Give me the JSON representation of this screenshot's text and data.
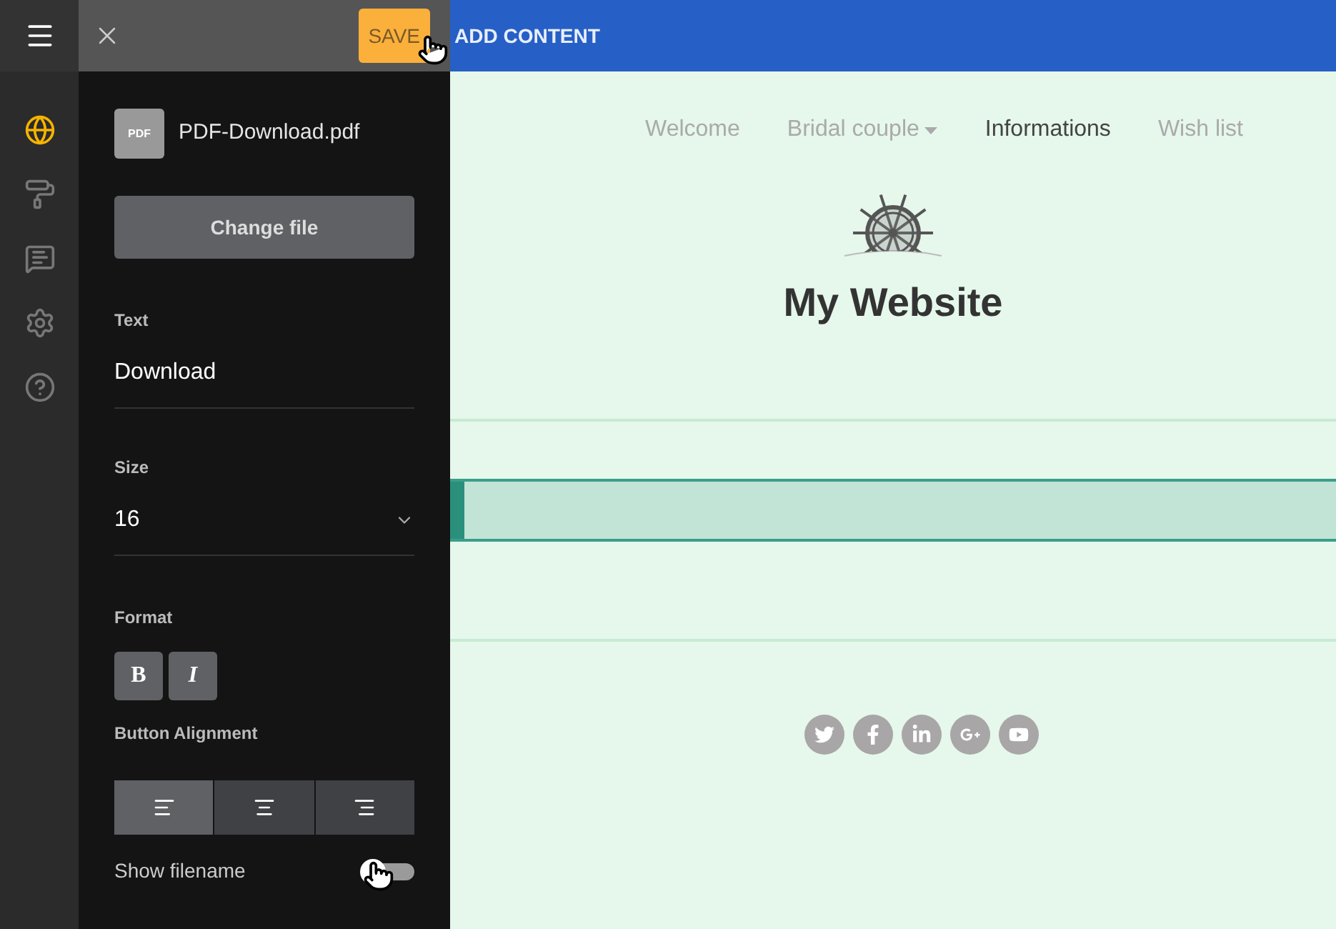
{
  "rail_items": [
    {
      "kind": "globe",
      "selected": true
    },
    {
      "kind": "paint",
      "selected": false
    },
    {
      "kind": "edit",
      "selected": false
    },
    {
      "kind": "settings",
      "selected": false
    },
    {
      "kind": "help",
      "selected": false
    }
  ],
  "panel": {
    "save_button": "SAVE",
    "file": {
      "badge": "PDF",
      "name": "PDF-Download.pdf"
    },
    "change_file_button": "Change file",
    "text_field": {
      "label": "Text",
      "value": "Download"
    },
    "size_field": {
      "label": "Size",
      "value": "16"
    },
    "format": {
      "label": "Format",
      "buttons": [
        {
          "kind": "bold",
          "label": "B",
          "selected": false
        },
        {
          "kind": "italic",
          "label": "I",
          "selected": false
        }
      ]
    },
    "alignment": {
      "label": "Button Alignment",
      "options": [
        {
          "kind": "left",
          "selected": true
        },
        {
          "kind": "center",
          "selected": false
        },
        {
          "kind": "right",
          "selected": false
        }
      ]
    },
    "show_filename": {
      "label": "Show filename",
      "on": false
    }
  },
  "topbar": {
    "add_content": "ADD CONTENT"
  },
  "site": {
    "nav": [
      {
        "label": "Welcome",
        "selected": false,
        "dropdown": false
      },
      {
        "label": "Bridal couple",
        "selected": false,
        "dropdown": true
      },
      {
        "label": "Informations",
        "selected": true,
        "dropdown": false
      },
      {
        "label": "Wish list",
        "selected": false,
        "dropdown": false
      }
    ],
    "title": "My Website",
    "social": [
      {
        "kind": "twitter"
      },
      {
        "kind": "facebook"
      },
      {
        "kind": "linkedin"
      },
      {
        "kind": "googleplus"
      },
      {
        "kind": "youtube"
      }
    ]
  }
}
